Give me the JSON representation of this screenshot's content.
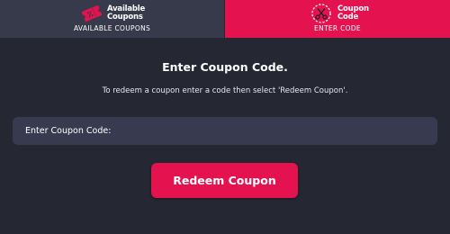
{
  "tabs": {
    "available": {
      "logo_line1": "Available",
      "logo_line2": "Coupons",
      "caption": "AVAILABLE COUPONS",
      "icon": "coupon-ticket-icon"
    },
    "enter": {
      "logo_line1": "Coupon",
      "logo_line2": "Code",
      "caption": "ENTER CODE",
      "icon": "coupon-scissors-icon",
      "active": true
    }
  },
  "main": {
    "title": "Enter Coupon Code.",
    "instructions": "To redeem a coupon enter a code then select 'Redeem Coupon'.",
    "field_placeholder": "Enter Coupon Code:",
    "field_value": "",
    "redeem_label": "Redeem Coupon"
  },
  "colors": {
    "background": "#252733",
    "tab_inactive": "#373a4a",
    "accent": "#e4124f",
    "field": "#383b4f"
  }
}
